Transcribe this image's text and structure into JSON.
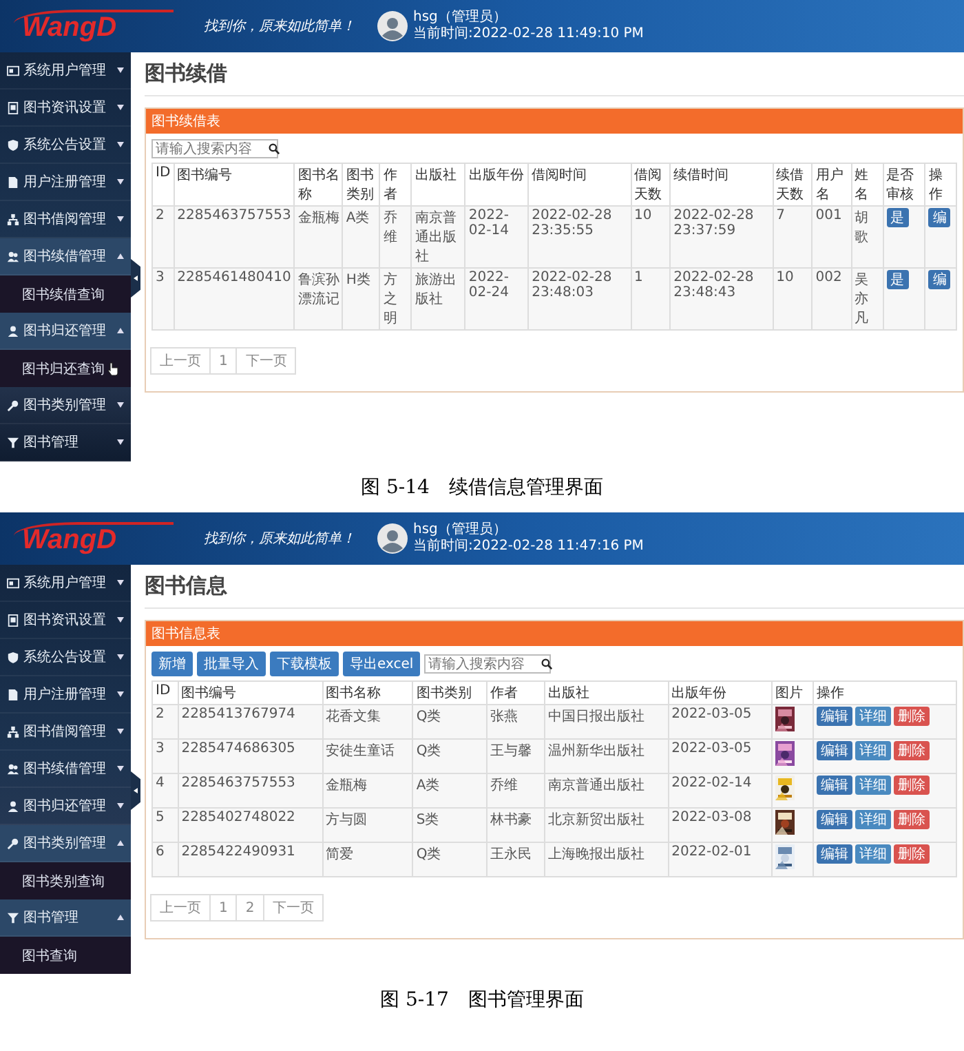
{
  "screens": [
    {
      "header": {
        "logo": "WangD",
        "slogan": "找到你，原来如此简单！",
        "user": "hsg（管理员）",
        "time": "当前时间:2022-02-28 11:49:10 PM"
      },
      "sidebar": {
        "items": [
          {
            "label": "系统用户管理",
            "expanded": false
          },
          {
            "label": "图书资讯设置",
            "expanded": false
          },
          {
            "label": "系统公告设置",
            "expanded": false
          },
          {
            "label": "用户注册管理",
            "expanded": false
          },
          {
            "label": "图书借阅管理",
            "expanded": false
          },
          {
            "label": "图书续借管理",
            "expanded": true,
            "children": [
              {
                "label": "图书续借查询",
                "hovered": false
              }
            ]
          },
          {
            "label": "图书归还管理",
            "expanded": true,
            "children": [
              {
                "label": "图书归还查询",
                "hovered": true
              }
            ]
          },
          {
            "label": "图书类别管理",
            "expanded": false
          },
          {
            "label": "图书管理",
            "expanded": false
          }
        ]
      },
      "page_title": "图书续借",
      "panel": {
        "title": "图书续借表",
        "search": {
          "placeholder": "请输入搜索内容"
        },
        "table": {
          "columns": [
            "ID",
            "图书编号",
            "图书名称",
            "图书类别",
            "作者",
            "出版社",
            "出版年份",
            "借阅时间",
            "借阅天数",
            "续借时间",
            "续借天数",
            "用户名",
            "姓名",
            "是否审核",
            "操作"
          ],
          "rows": [
            {
              "cells": [
                "2",
                "2285463757553",
                "金瓶梅",
                "A类",
                "乔维",
                "南京普通出版社",
                "2022-02-14",
                "2022-02-28 23:35:55",
                "10",
                "2022-02-28 23:37:59",
                "7",
                "001",
                "胡歌"
              ],
              "extra": {
                "kind": "badge",
                "text": "是"
              },
              "actions": [
                {
                  "label": "编",
                  "kind": "primary"
                }
              ]
            },
            {
              "cells": [
                "3",
                "2285461480410",
                "鲁滨孙漂流记",
                "H类",
                "方之明",
                "旅游出版社",
                "2022-02-24",
                "2022-02-28 23:48:03",
                "1",
                "2022-02-28 23:48:43",
                "10",
                "002",
                "吴亦凡"
              ],
              "extra": {
                "kind": "badge",
                "text": "是"
              },
              "actions": [
                {
                  "label": "编",
                  "kind": "primary"
                }
              ]
            }
          ]
        },
        "pagination": [
          "上一页",
          "1",
          "下一页"
        ]
      },
      "caption": {
        "number": "图 5-14",
        "text": "续借信息管理界面"
      }
    },
    {
      "header": {
        "logo": "WangD",
        "slogan": "找到你，原来如此简单！",
        "user": "hsg（管理员）",
        "time": "当前时间:2022-02-28 11:47:16 PM"
      },
      "sidebar": {
        "items": [
          {
            "label": "系统用户管理",
            "expanded": false
          },
          {
            "label": "图书资讯设置",
            "expanded": false
          },
          {
            "label": "系统公告设置",
            "expanded": false
          },
          {
            "label": "用户注册管理",
            "expanded": false
          },
          {
            "label": "图书借阅管理",
            "expanded": false
          },
          {
            "label": "图书续借管理",
            "expanded": false
          },
          {
            "label": "图书归还管理",
            "expanded": false
          },
          {
            "label": "图书类别管理",
            "expanded": true,
            "children": [
              {
                "label": "图书类别查询",
                "hovered": false
              }
            ]
          },
          {
            "label": "图书管理",
            "expanded": true,
            "children": [
              {
                "label": "图书查询",
                "hovered": false
              }
            ]
          }
        ]
      },
      "page_title": "图书信息",
      "panel": {
        "title": "图书信息表",
        "toolbar": [
          "新增",
          "批量导入",
          "下载模板",
          "导出excel"
        ],
        "search": {
          "placeholder": "请输入搜索内容"
        },
        "table": {
          "columns": [
            "ID",
            "图书编号",
            "图书名称",
            "图书类别",
            "作者",
            "出版社",
            "出版年份",
            "图片",
            "操作"
          ],
          "rows": [
            {
              "cells": [
                "2",
                "2285413767974",
                "花香文集",
                "Q类",
                "张燕",
                "中国日报出版社",
                "2022-03-05"
              ],
              "extra": {
                "kind": "picture"
              },
              "actions": [
                {
                  "label": "编辑",
                  "kind": "primary"
                },
                {
                  "label": "详细",
                  "kind": "info"
                },
                {
                  "label": "删除",
                  "kind": "danger"
                }
              ]
            },
            {
              "cells": [
                "3",
                "2285474686305",
                "安徒生童话",
                "Q类",
                "王与馨",
                "温州新华出版社",
                "2022-03-05"
              ],
              "extra": {
                "kind": "picture"
              },
              "actions": [
                {
                  "label": "编辑",
                  "kind": "primary"
                },
                {
                  "label": "详细",
                  "kind": "info"
                },
                {
                  "label": "删除",
                  "kind": "danger"
                }
              ]
            },
            {
              "cells": [
                "4",
                "2285463757553",
                "金瓶梅",
                "A类",
                "乔维",
                "南京普通出版社",
                "2022-02-14"
              ],
              "extra": {
                "kind": "picture"
              },
              "actions": [
                {
                  "label": "编辑",
                  "kind": "primary"
                },
                {
                  "label": "详细",
                  "kind": "info"
                },
                {
                  "label": "删除",
                  "kind": "danger"
                }
              ]
            },
            {
              "cells": [
                "5",
                "2285402748022",
                "方与圆",
                "S类",
                "林书豪",
                "北京新贸出版社",
                "2022-03-08"
              ],
              "extra": {
                "kind": "picture"
              },
              "actions": [
                {
                  "label": "编辑",
                  "kind": "primary"
                },
                {
                  "label": "详细",
                  "kind": "info"
                },
                {
                  "label": "删除",
                  "kind": "danger"
                }
              ]
            },
            {
              "cells": [
                "6",
                "2285422490931",
                "简爱",
                "Q类",
                "王永民",
                "上海晚报出版社",
                "2022-02-01"
              ],
              "extra": {
                "kind": "picture"
              },
              "actions": [
                {
                  "label": "编辑",
                  "kind": "primary"
                },
                {
                  "label": "详细",
                  "kind": "info"
                },
                {
                  "label": "删除",
                  "kind": "danger"
                }
              ]
            }
          ]
        },
        "pagination": [
          "上一页",
          "1",
          "2",
          "下一页"
        ]
      },
      "caption": {
        "number": "图 5-17",
        "text": "图书管理界面"
      }
    }
  ]
}
